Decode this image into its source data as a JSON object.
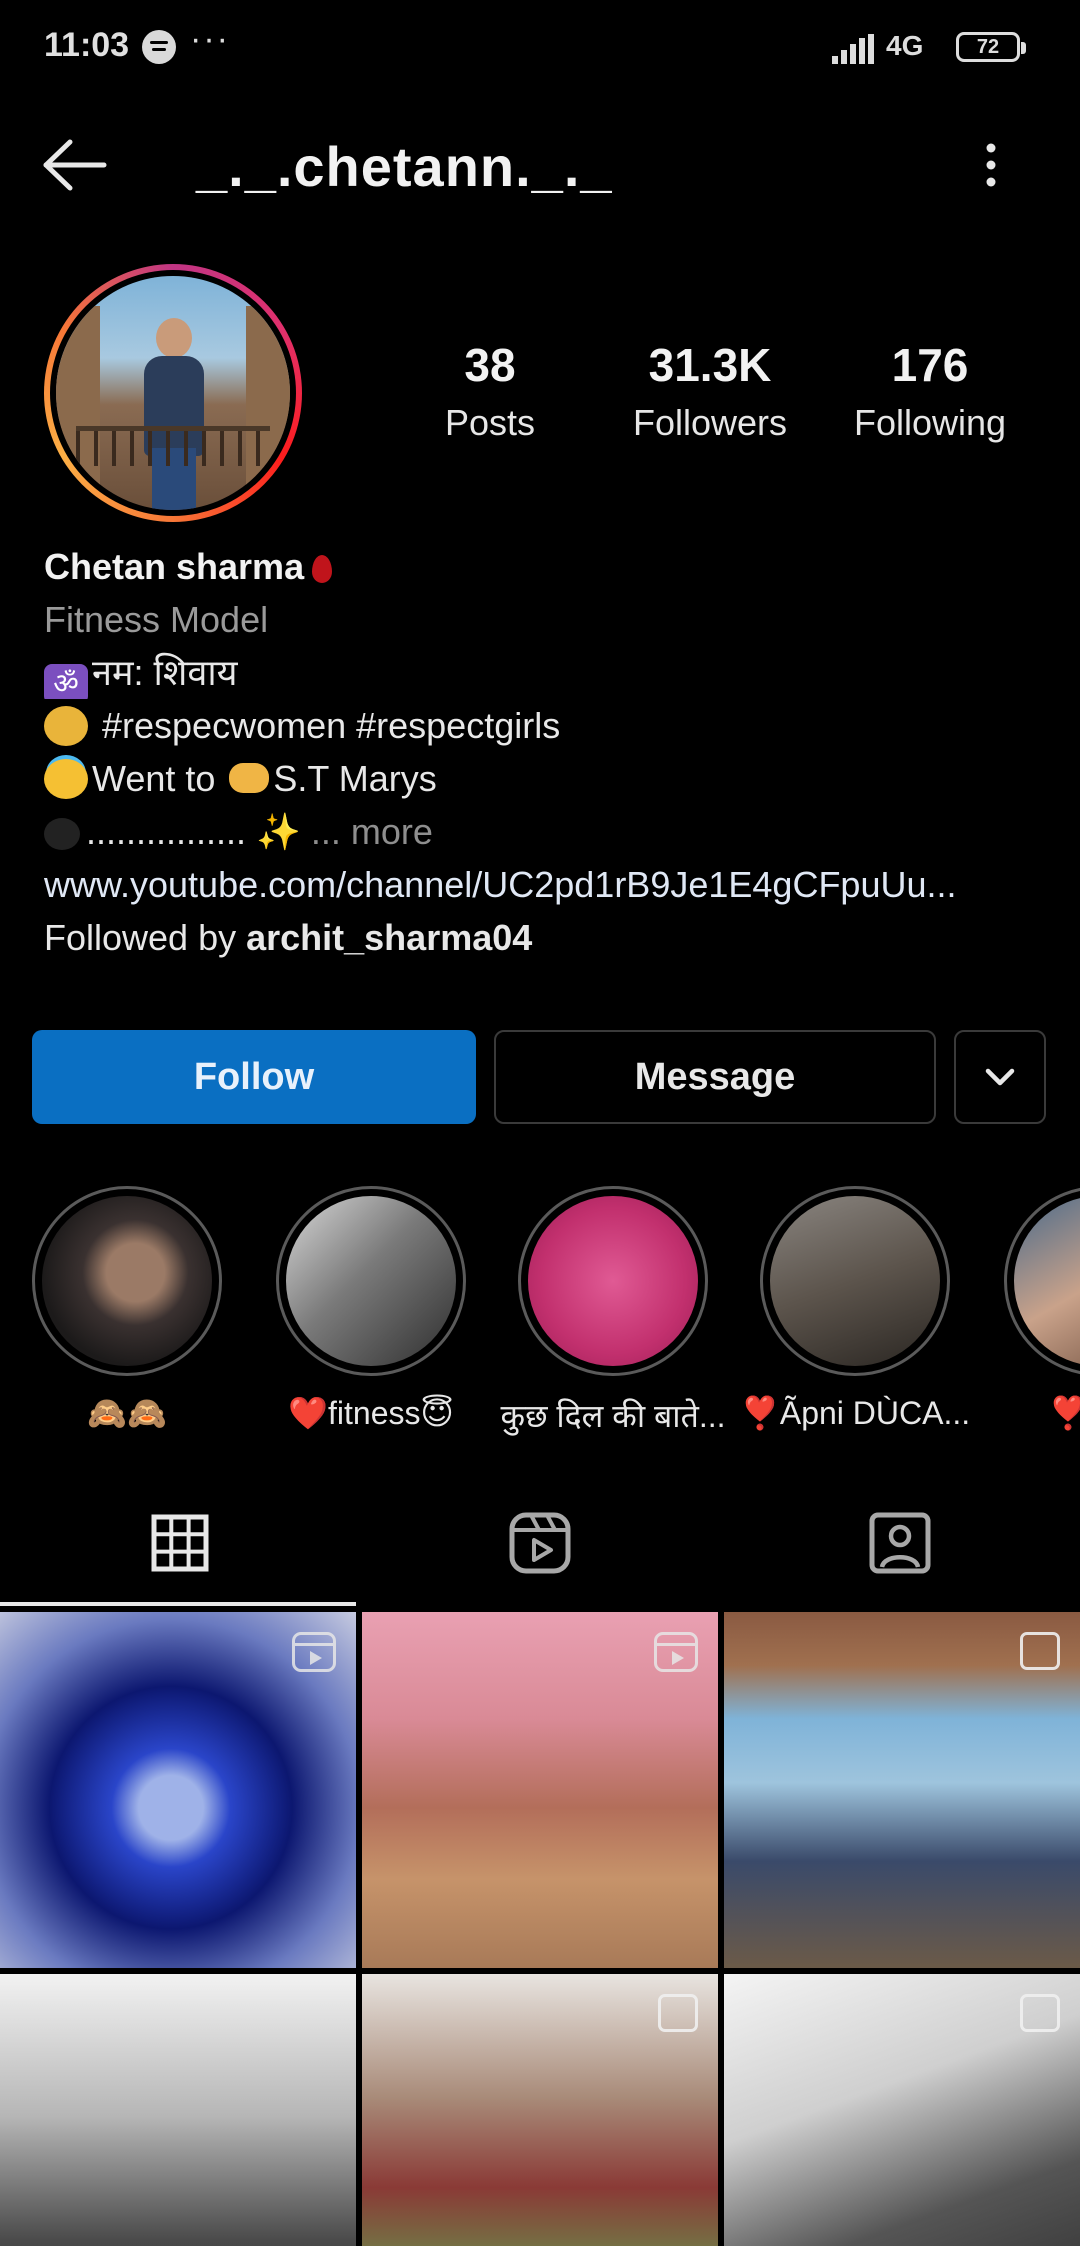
{
  "status_bar": {
    "time": "11:03",
    "network": "4G",
    "battery": "72"
  },
  "header": {
    "username": "_._.chetann._._"
  },
  "stats": {
    "posts_count": "38",
    "posts_label": "Posts",
    "followers_count": "31.3K",
    "followers_label": "Followers",
    "following_count": "176",
    "following_label": "Following"
  },
  "bio": {
    "name": "Chetan sharma",
    "category": "Fitness Model",
    "line1": "नम: शिवाय",
    "line2": " #respecwomen #respectgirls",
    "line3_a": "Went to ",
    "line3_b": "S.T Marys",
    "line4_dots": "................ ",
    "line4_sparkle": "✨",
    "more": "... more",
    "link": "www.youtube.com/channel/UC2pd1rB9Je1E4gCFpuUu...",
    "followed_by_prefix": "Followed by ",
    "followed_by_user": "archit_sharma04"
  },
  "buttons": {
    "follow": "Follow",
    "message": "Message"
  },
  "highlights": [
    {
      "label": "🙈🙈"
    },
    {
      "label": "❤️fitness😇"
    },
    {
      "label": "कुछ दिल की बाते..."
    },
    {
      "label": "❣️Ãpni DÙCA..."
    },
    {
      "label": "❣️Men"
    }
  ],
  "colors": {
    "follow_blue": "#0a6fc2",
    "background": "#000000",
    "text": "#fafafa"
  }
}
